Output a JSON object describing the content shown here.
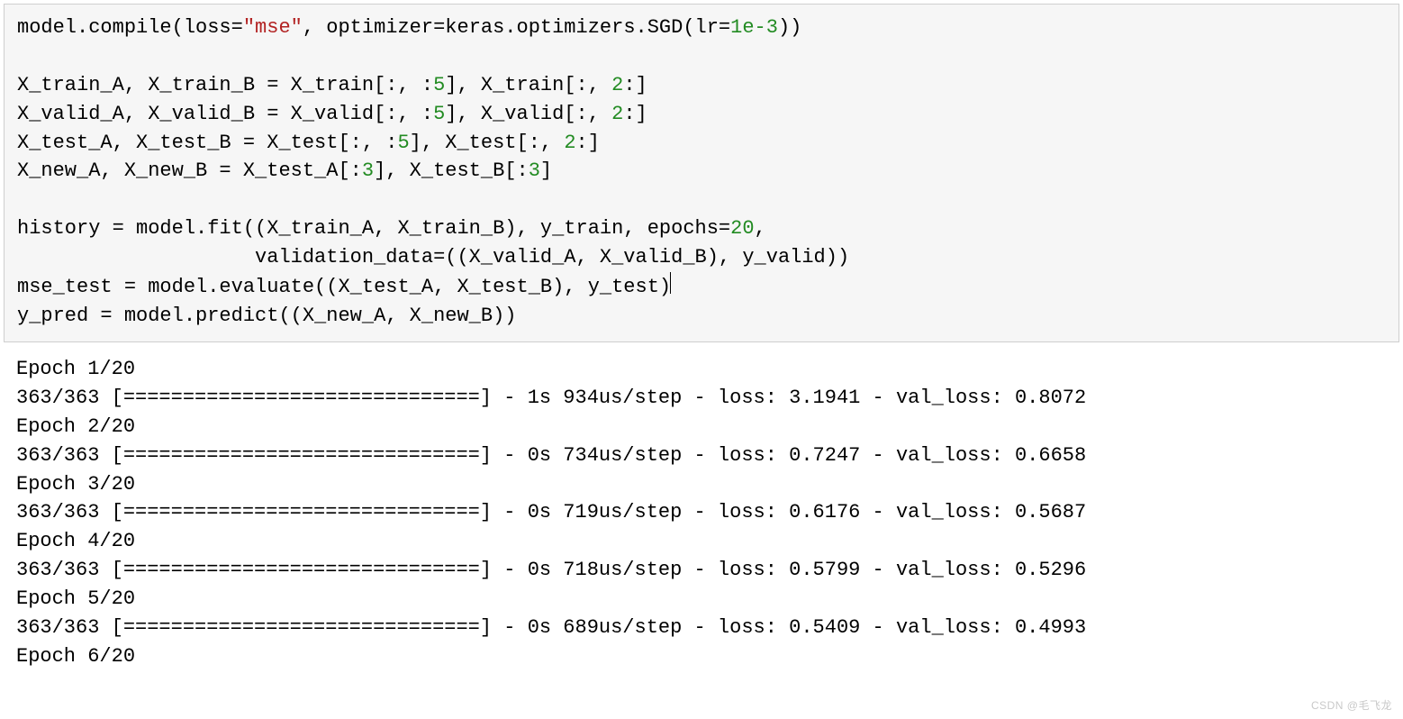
{
  "code": {
    "l1a": "model.compile(loss=",
    "l1b": "\"mse\"",
    "l1c": ", optimizer=keras.optimizers.SGD(lr=",
    "l1d": "1e-3",
    "l1e": "))",
    "l2": "",
    "l3a": "X_train_A, X_train_B = X_train[:, :",
    "l3b": "5",
    "l3c": "], X_train[:, ",
    "l3d": "2",
    "l3e": ":]",
    "l4a": "X_valid_A, X_valid_B = X_valid[:, :",
    "l4b": "5",
    "l4c": "], X_valid[:, ",
    "l4d": "2",
    "l4e": ":]",
    "l5a": "X_test_A, X_test_B = X_test[:, :",
    "l5b": "5",
    "l5c": "], X_test[:, ",
    "l5d": "2",
    "l5e": ":]",
    "l6a": "X_new_A, X_new_B = X_test_A[:",
    "l6b": "3",
    "l6c": "], X_test_B[:",
    "l6d": "3",
    "l6e": "]",
    "l7": "",
    "l8a": "history = model.fit((X_train_A, X_train_B), y_train, epochs=",
    "l8b": "20",
    "l8c": ",",
    "l9": "                    validation_data=((X_valid_A, X_valid_B), y_valid))",
    "l10": "mse_test = model.evaluate((X_test_A, X_test_B), y_test)",
    "l11": "y_pred = model.predict((X_new_A, X_new_B))"
  },
  "output": {
    "e1h": "Epoch 1/20",
    "e1b": "363/363 [==============================] - 1s 934us/step - loss: 3.1941 - val_loss: 0.8072",
    "e2h": "Epoch 2/20",
    "e2b": "363/363 [==============================] - 0s 734us/step - loss: 0.7247 - val_loss: 0.6658",
    "e3h": "Epoch 3/20",
    "e3b": "363/363 [==============================] - 0s 719us/step - loss: 0.6176 - val_loss: 0.5687",
    "e4h": "Epoch 4/20",
    "e4b": "363/363 [==============================] - 0s 718us/step - loss: 0.5799 - val_loss: 0.5296",
    "e5h": "Epoch 5/20",
    "e5b": "363/363 [==============================] - 0s 689us/step - loss: 0.5409 - val_loss: 0.4993",
    "e6h": "Epoch 6/20"
  },
  "watermark": "CSDN @毛飞龙"
}
